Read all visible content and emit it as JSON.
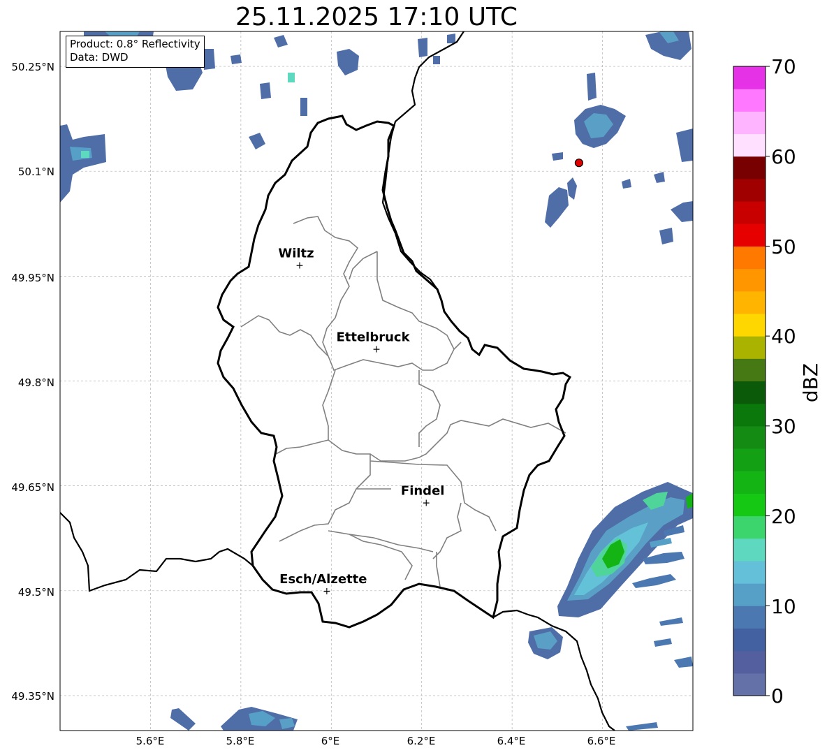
{
  "title": "25.11.2025 17:10 UTC",
  "info_box": {
    "product": "Product: 0.8° Reflectivity",
    "data": "Data: DWD"
  },
  "axes": {
    "lon_ticks": [
      "5.6°E",
      "5.8°E",
      "6°E",
      "6.2°E",
      "6.4°E",
      "6.6°E"
    ],
    "lat_ticks": [
      "50.25°N",
      "50.1°N",
      "49.95°N",
      "49.8°N",
      "49.65°N",
      "49.5°N",
      "49.35°N"
    ]
  },
  "cities": [
    {
      "name": "Wiltz",
      "lon": 5.93,
      "lat": 49.966
    },
    {
      "name": "Ettelbruck",
      "lon": 6.1,
      "lat": 49.846
    },
    {
      "name": "Findel",
      "lon": 6.21,
      "lat": 49.626
    },
    {
      "name": "Esch/Alzette",
      "lon": 5.99,
      "lat": 49.5
    }
  ],
  "radar_site": {
    "lon": 6.548,
    "lat": 50.112,
    "color": "#e00000"
  },
  "colorbar": {
    "label": "dBZ",
    "ticks": [
      "0",
      "10",
      "20",
      "30",
      "40",
      "50",
      "60",
      "70"
    ],
    "min": 0,
    "max": 70,
    "step": 2.5,
    "colors": [
      "#6470a8",
      "#535f9e",
      "#4360a0",
      "#4b78b0",
      "#56a0c8",
      "#64c0d8",
      "#5fd8c0",
      "#3cd46c",
      "#14c814",
      "#14b414",
      "#14a014",
      "#148c14",
      "#0a780a",
      "#0a5a0a",
      "#467814",
      "#aab400",
      "#ffd700",
      "#ffb400",
      "#ff9600",
      "#ff7800",
      "#e60000",
      "#c80000",
      "#a00000",
      "#780000",
      "#ffe0ff",
      "#ffb4ff",
      "#ff78ff",
      "#e632e6"
    ]
  }
}
